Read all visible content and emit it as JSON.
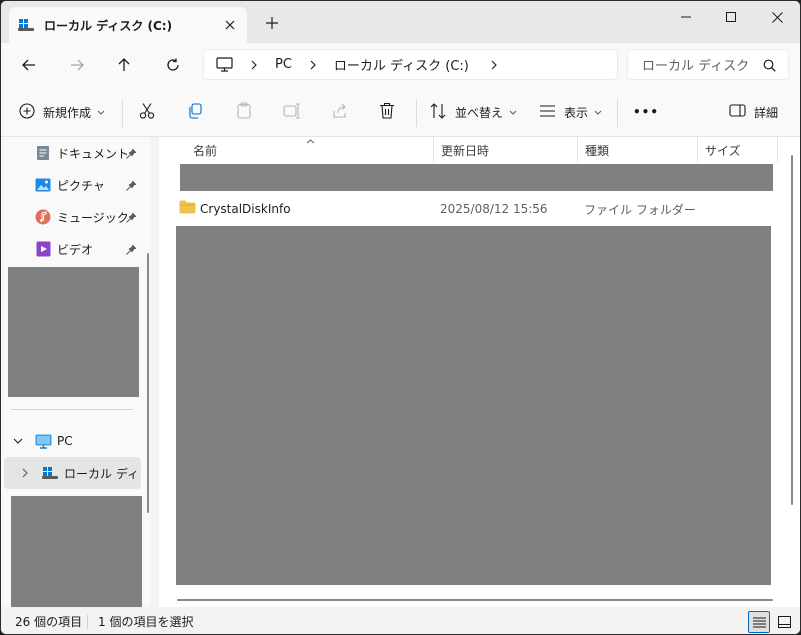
{
  "tab": {
    "title": "ローカル ディスク (C:)"
  },
  "window_controls": {
    "new_tab": "+"
  },
  "breadcrumb": [
    "PC",
    "ローカル ディスク (C:)"
  ],
  "search": {
    "placeholder": "ローカル ディスク (C:) の検索"
  },
  "toolbar": {
    "new_label": "新規作成",
    "sort_label": "並べ替え",
    "view_label": "表示",
    "more_label": "•••",
    "details_label": "詳細"
  },
  "sidebar": {
    "quick_items": [
      {
        "label": "ドキュメント",
        "icon": "document-icon"
      },
      {
        "label": "ピクチャ",
        "icon": "pictures-icon"
      },
      {
        "label": "ミュージック",
        "icon": "music-icon"
      },
      {
        "label": "ビデオ",
        "icon": "video-icon"
      }
    ],
    "pc_label": "PC",
    "drive_label": "ローカル ディスク (C:)"
  },
  "columns": {
    "name": "名前",
    "modified": "更新日時",
    "type": "種類",
    "size": "サイズ"
  },
  "rows": [
    {
      "name": "CrystalDiskInfo",
      "modified": "2025/08/12 15:56",
      "type": "ファイル フォルダー",
      "size": ""
    }
  ],
  "status": {
    "item_count": "26 個の項目",
    "selected": "1 個の項目を選択"
  },
  "colors": {
    "accent": "#0067c0",
    "redacted": "#808080",
    "folder": "#f0c24b"
  }
}
